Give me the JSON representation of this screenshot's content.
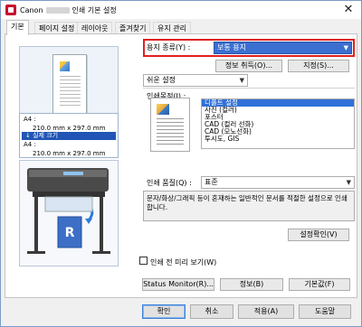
{
  "window": {
    "title_brand": "Canon",
    "title_main": "인쇄 기본 설정",
    "close_symbol": "✕"
  },
  "tabs": [
    {
      "label": "기본"
    },
    {
      "label": "페이지 설정"
    },
    {
      "label": "레이아웃"
    },
    {
      "label": "즐겨찾기"
    },
    {
      "label": "유지 관리"
    }
  ],
  "preview": {
    "size_a_label": "A4 :",
    "size_a_value": "210.0 mm x 297.0 mm",
    "scale_label": "↓ 실제 크기",
    "size_b_label": "A4 :",
    "size_b_value": "210.0 mm x 297.0 mm"
  },
  "media": {
    "label": "용지 종류(Y) :",
    "value": "보통 용지"
  },
  "buttons": {
    "info_get": "정보 취득(O)...",
    "specify": "지정(S)...",
    "settings_confirm": "설정확인(V)",
    "status_monitor": "Status Monitor(R)...",
    "info": "정보(B)",
    "defaults": "기본값(F)",
    "ok": "확인",
    "cancel": "취소",
    "apply": "적용(A)",
    "help": "도움말"
  },
  "mode_select": {
    "value": "쉬운 설정"
  },
  "purpose": {
    "label": "인쇄목적(I) :",
    "items": [
      "디폴트 설정",
      "사진 (컬러)",
      "포스터",
      "CAD (컬러 선화)",
      "CAD (모노선화)",
      "투시도, GIS"
    ],
    "selected_index": 0
  },
  "quality": {
    "label": "인쇄 품질(Q) :",
    "value": "표준"
  },
  "description": "문자/화상/그래픽 등이 혼재하는 일반적인 문서를 적절한 설정으로 인쇄합니다.",
  "preview_checkbox": {
    "label": "인쇄 전 미리 보기(W)",
    "checked": false
  }
}
